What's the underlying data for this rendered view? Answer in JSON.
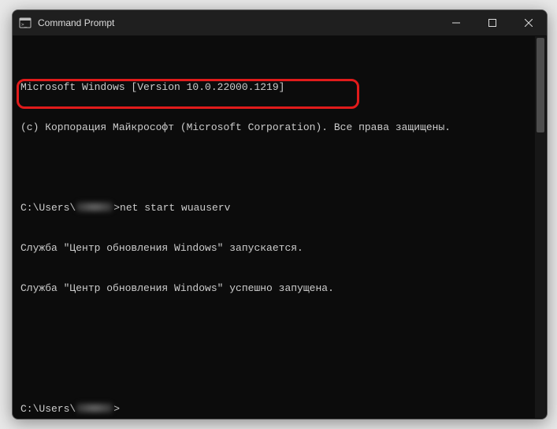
{
  "window": {
    "title": "Command Prompt"
  },
  "terminal": {
    "line1": "Microsoft Windows [Version 10.0.22000.1219]",
    "line2": "(c) Корпорация Майкрософт (Microsoft Corporation). Все права защищены.",
    "prompt1_prefix": "C:\\Users\\",
    "command1": ">net start wuauserv",
    "line4": "Служба \"Центр обновления Windows\" запускается.",
    "line5": "Служба \"Центр обновления Windows\" успешно запущена.",
    "prompt2_prefix": "C:\\Users\\",
    "prompt2_suffix": ">"
  }
}
